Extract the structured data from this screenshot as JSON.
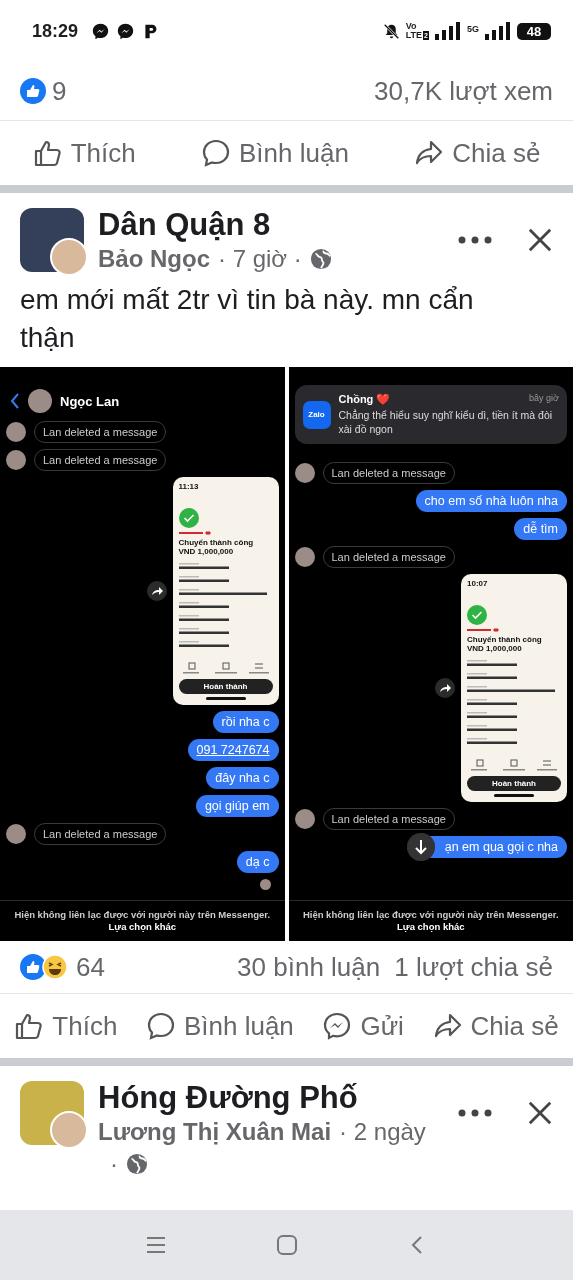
{
  "status_bar": {
    "time": "18:29",
    "volte_top": "Vo",
    "volte_bottom": "LTE",
    "sim_index": "2",
    "network": "5G",
    "battery": "48"
  },
  "prev_post": {
    "like_count": "9",
    "views": "30,7K lượt xem",
    "actions": [
      {
        "kind": "like",
        "label": "Thích"
      },
      {
        "kind": "comment",
        "label": "Bình luận"
      },
      {
        "kind": "share",
        "label": "Chia sẻ"
      }
    ]
  },
  "post": {
    "group": "Dân Quận 8",
    "author": "Bảo Ngọc",
    "meta": "· 7 giờ ·",
    "text": "em mới mất 2tr vì tin bà này. mn cẩn thận",
    "screenshots": [
      {
        "header": {
          "name": "Ngọc Lan"
        },
        "messages": [
          {
            "kind": "deleted",
            "text": "Lan deleted a message"
          },
          {
            "kind": "deleted",
            "text": "Lan deleted a message"
          },
          {
            "kind": "receipt",
            "time": "11:13",
            "title": "Chuyển thành công",
            "amount": "VND 1,000,000",
            "button": "Hoàn thành"
          },
          {
            "kind": "sent",
            "text": "rồi nha c"
          },
          {
            "kind": "sent_link",
            "text": "091 7247674"
          },
          {
            "kind": "sent",
            "text": "đây nha c"
          },
          {
            "kind": "sent",
            "text": "gọi giúp em"
          },
          {
            "kind": "deleted",
            "text": "Lan deleted a message"
          },
          {
            "kind": "sent",
            "text": "dạ c"
          },
          {
            "kind": "seen"
          }
        ],
        "footer": "Hiện không liên lạc được với người này trên Messenger. **Lựa chọn khác**"
      },
      {
        "notification": {
          "app": "Zalo",
          "title": "Chồng ❤️",
          "time": "bây giờ",
          "body": "Chẳng thể hiểu suy nghĩ kiểu dì, tiền ít mà đòi xài đồ ngon"
        },
        "messages": [
          {
            "kind": "deleted",
            "text": "Lan deleted a message"
          },
          {
            "kind": "sent",
            "text": "cho em số nhà luôn nha"
          },
          {
            "kind": "sent",
            "text": "dễ tìm"
          },
          {
            "kind": "deleted",
            "text": "Lan deleted a message"
          },
          {
            "kind": "receipt",
            "time": "10:07",
            "title": "Chuyển thành công",
            "amount": "VND 1,000,000",
            "button": "Hoàn thành"
          },
          {
            "kind": "deleted",
            "text": "Lan deleted a message"
          },
          {
            "kind": "sent_covered",
            "text": "ạn em qua gọi c nha"
          }
        ],
        "footer": "Hiện không liên lạc được với người này trên Messenger. **Lựa chọn khác**"
      }
    ],
    "reaction_count": "64",
    "comments": "30 bình luận",
    "shares": "1 lượt chia sẻ",
    "actions": [
      {
        "kind": "like",
        "label": "Thích"
      },
      {
        "kind": "comment",
        "label": "Bình luận"
      },
      {
        "kind": "send",
        "label": "Gửi"
      },
      {
        "kind": "share",
        "label": "Chia sẻ"
      }
    ]
  },
  "next_post": {
    "group": "Hóng Đường Phố",
    "author": "Lương Thị Xuân Mai",
    "meta": "· 2 ngày",
    "meta_dot": "·"
  }
}
